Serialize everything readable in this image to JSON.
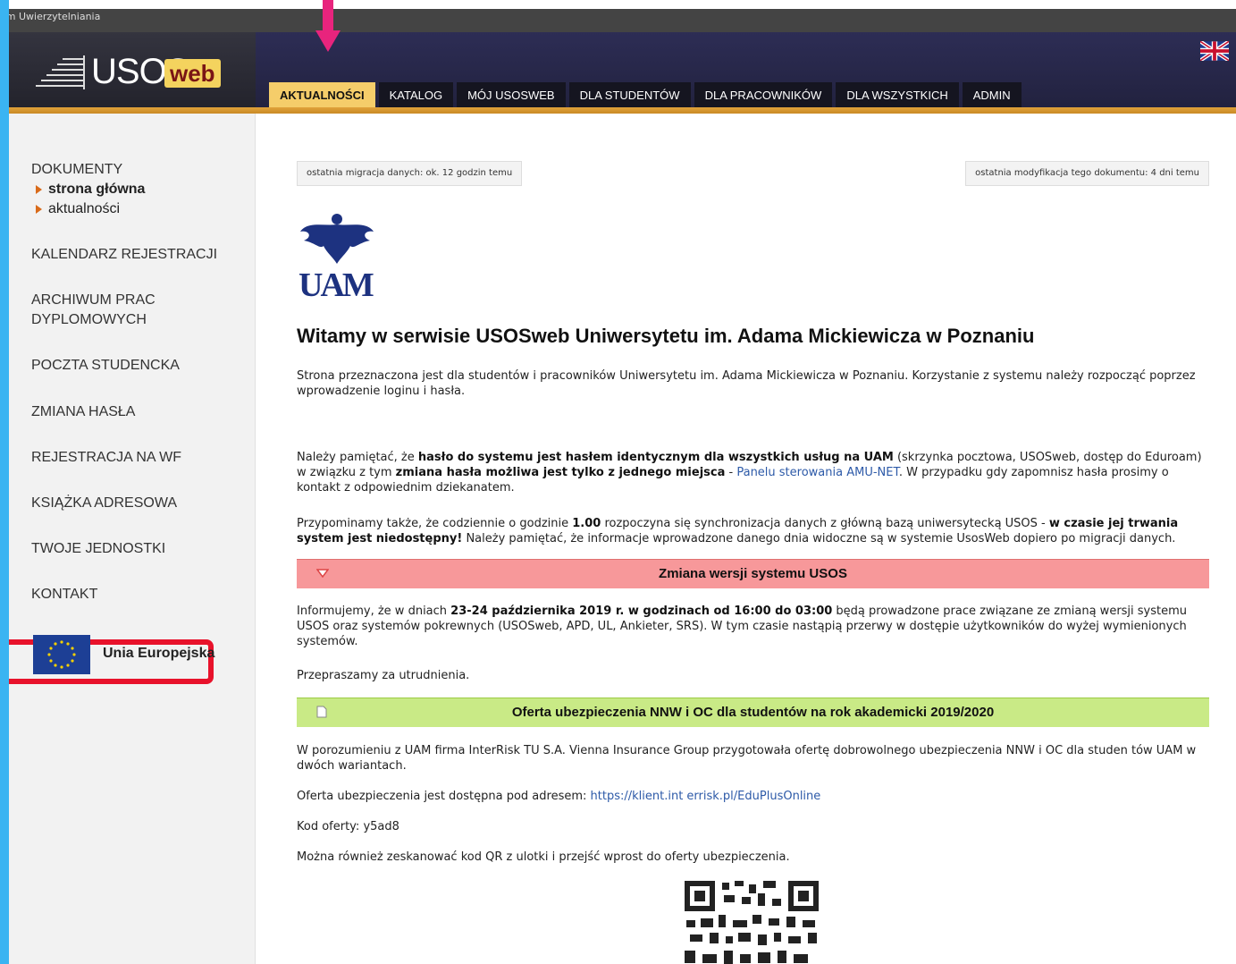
{
  "browser": {
    "top_label": "em Uwierzytelniania"
  },
  "header": {
    "logo_main": "USOS",
    "logo_badge": "web",
    "language_flag": "uk-flag-icon"
  },
  "nav": {
    "tabs": [
      {
        "label": "AKTUALNOŚCI",
        "active": true
      },
      {
        "label": "KATALOG"
      },
      {
        "label": "MÓJ USOSWEB"
      },
      {
        "label": "DLA STUDENTÓW"
      },
      {
        "label": "DLA PRACOWNIKÓW"
      },
      {
        "label": "DLA WSZYSTKICH"
      },
      {
        "label": "ADMIN"
      }
    ]
  },
  "sidebar": {
    "dokumenty": "DOKUMENTY",
    "sub_strona": "strona główna",
    "sub_aktualnosci": "aktualności",
    "kalendarz": "KALENDARZ REJESTRACJI",
    "archiwum_1": "ARCHIWUM PRAC",
    "archiwum_2": "DYPLOMOWYCH",
    "poczta": "POCZTA STUDENCKA",
    "zmiana": "ZMIANA HASŁA",
    "rejestracja_wf": "REJESTRACJA NA WF",
    "ksiazka": "KSIĄŻKA ADRESOWA",
    "twoje": "TWOJE JEDNOSTKI",
    "kontakt": "KONTAKT",
    "eu_label": "Unia Europejska"
  },
  "main": {
    "stamp_left": "ostatnia migracja danych: ok. 12 godzin temu",
    "stamp_right": "ostatnia modyfikacja tego dokumentu: 4 dni temu",
    "crest_text": "UAM",
    "heading": "Witamy w serwisie USOSweb Uniwersytetu im. Adama Mickiewicza w Poznaniu",
    "intro": "Strona przeznaczona jest dla studentów i pracowników Uniwersytetu im. Adama Mickiewicza w Poznaniu. Korzystanie z systemu należy rozpocząć poprzez wprowadzenie loginu i hasła.",
    "p2_a": "Należy pamiętać, że ",
    "p2_b": "hasło do systemu jest hasłem identycznym dla wszystkich usług na UAM",
    "p2_c": " (skrzynka pocztowa, USOSweb, dostęp do Eduroam) w związku z tym ",
    "p2_d": "zmiana hasła możliwa jest tylko z jednego miejsca",
    "p2_e": " - ",
    "p2_link": "Panelu sterowania AMU-NET",
    "p2_f": ". W przypadku gdy zapomnisz hasła prosimy o kontakt z odpowiednim dziekanatem.",
    "p3_a": "Przypominamy także, że codziennie o godzinie ",
    "p3_b": "1.00",
    "p3_c": " rozpoczyna się synchronizacja danych z główną bazą uniwersytecką USOS - ",
    "p3_d": "w czasie jej trwania system jest niedostępny!",
    "p3_e": " Należy pamiętać, że informacje wprowadzone danego dnia widoczne są w systemie UsosWeb dopiero po migracji danych.",
    "banner1": "Zmiana wersji systemu USOS",
    "p4_a": "Informujemy, że w dniach ",
    "p4_b": "23-24 października 2019 r. w godzinach od 16:00 do 03:00",
    "p4_c": " będą prowadzone prace związane ze zmianą wersji systemu USOS oraz systemów pokrewnych (USOSweb, APD, UL, Ankieter, SRS). W tym czasie nastąpią przerwy w dostępie użytkowników do wyżej wymienionych systemów.",
    "p5": "Przepraszamy za utrudnienia.",
    "banner2": "Oferta ubezpieczenia NNW i OC dla studentów na rok akademicki 2019/2020",
    "p6": "W porozumieniu z UAM firma InterRisk TU S.A. Vienna Insurance Group przygotowała ofertę dobrowolnego ubezpieczenia NNW i OC dla studen tów UAM w dwóch wariantach.",
    "p7_a": "Oferta ubezpieczenia jest dostępna pod adresem: ",
    "p7_link": "https://klient.int errisk.pl/EduPlusOnline",
    "p8": "Kod oferty: y5ad8",
    "p9": "Można również zeskanować kod QR z ulotki i przejść wprost do oferty ubezpieczenia."
  },
  "colors": {
    "accent_tab": "#f5cd6a",
    "annotation_arrow": "#e8247d",
    "annotation_box": "#e8122b",
    "red_banner": "#f7989a",
    "green_banner": "#c9ea86"
  }
}
